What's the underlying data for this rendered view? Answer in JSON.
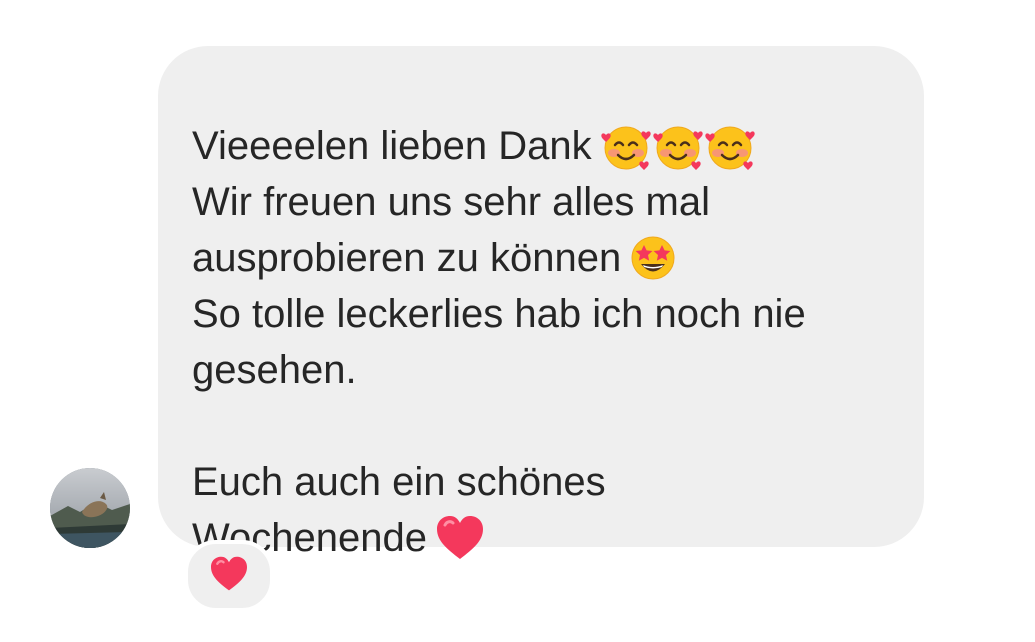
{
  "message": {
    "lines": [
      "Vieeeelen lieben Dank",
      "Wir freuen uns sehr alles mal",
      "ausprobieren zu können",
      "So tolle leckerlies hab ich noch nie",
      "gesehen.",
      "",
      "Euch auch ein schönes",
      "Wochenende"
    ],
    "emojis": {
      "line1": [
        "smiling-face-with-hearts",
        "smiling-face-with-hearts",
        "smiling-face-with-hearts"
      ],
      "line3": "star-struck",
      "line8": "red-heart"
    }
  },
  "reaction": {
    "emoji": "red-heart"
  },
  "colors": {
    "bubble": "#efefef",
    "text": "#262626",
    "heart": "#f4385c"
  }
}
